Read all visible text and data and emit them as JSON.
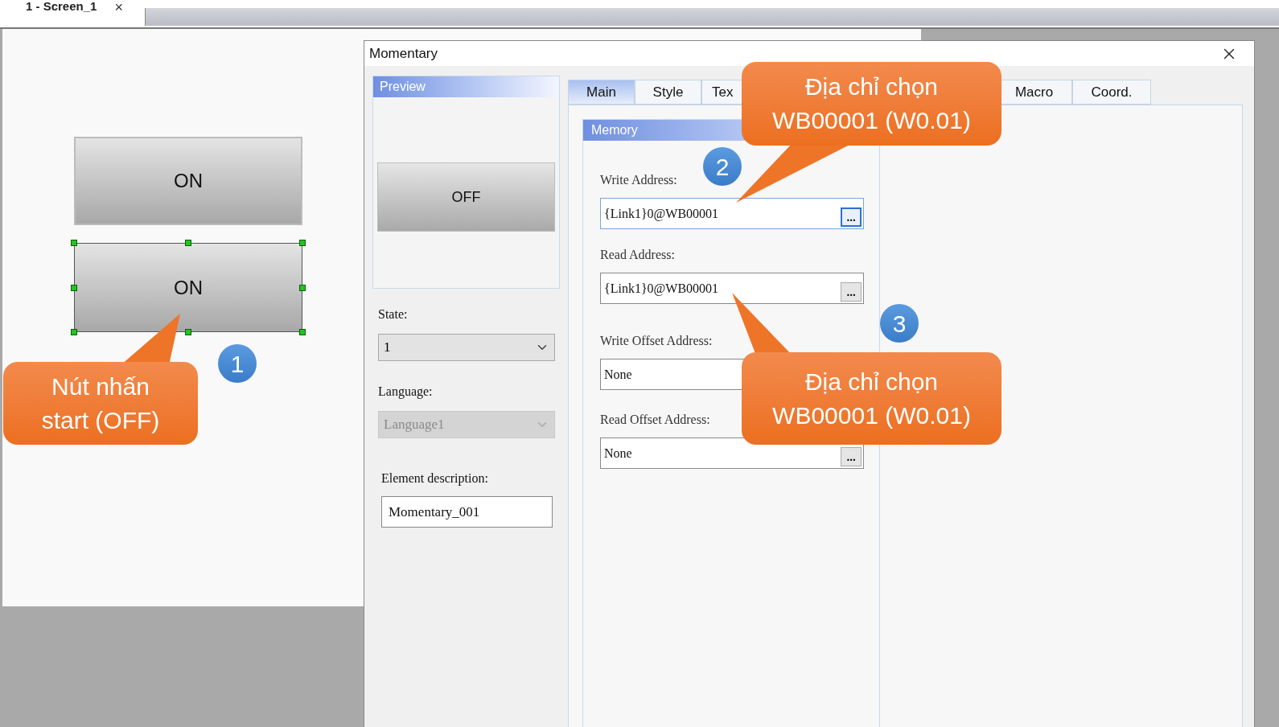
{
  "document_tab": {
    "label": "1 - Screen_1",
    "close": "×"
  },
  "canvas": {
    "buttons": [
      {
        "label": "ON",
        "selected": false
      },
      {
        "label": "ON",
        "selected": true
      }
    ]
  },
  "dialog": {
    "title": "Momentary",
    "preview": {
      "title": "Preview",
      "button": "OFF"
    },
    "state": {
      "label": "State:",
      "value": "1"
    },
    "language": {
      "label": "Language:",
      "value": "Language1",
      "disabled": true
    },
    "description": {
      "label": "Element description:",
      "value": "Momentary_001"
    },
    "tabs": [
      {
        "label": "Main",
        "selected": true
      },
      {
        "label": "Style",
        "selected": false
      },
      {
        "label": "Tex",
        "selected": false
      },
      {
        "label": "Macro",
        "selected": false
      },
      {
        "label": "Coord.",
        "selected": false
      }
    ],
    "memory": {
      "title": "Memory",
      "fields": [
        {
          "label": "Write Address:",
          "value": "{Link1}0@WB00001",
          "browse": "...",
          "focused": true
        },
        {
          "label": "Read Address:",
          "value": "{Link1}0@WB00001",
          "browse": "...",
          "focused": false
        },
        {
          "label": "Write Offset Address:",
          "value": "None",
          "focused": false
        },
        {
          "label": "Read Offset Address:",
          "value": "None",
          "browse": "...",
          "focused": false
        }
      ]
    }
  },
  "markers": [
    "1",
    "2",
    "3"
  ],
  "callouts": [
    {
      "text": "Nút nhấn\nstart (OFF)"
    },
    {
      "text": "Địa chỉ chọn\nWB00001 (W0.01)"
    },
    {
      "text": "Địa chỉ chọn\nWB00001 (W0.01)"
    }
  ]
}
